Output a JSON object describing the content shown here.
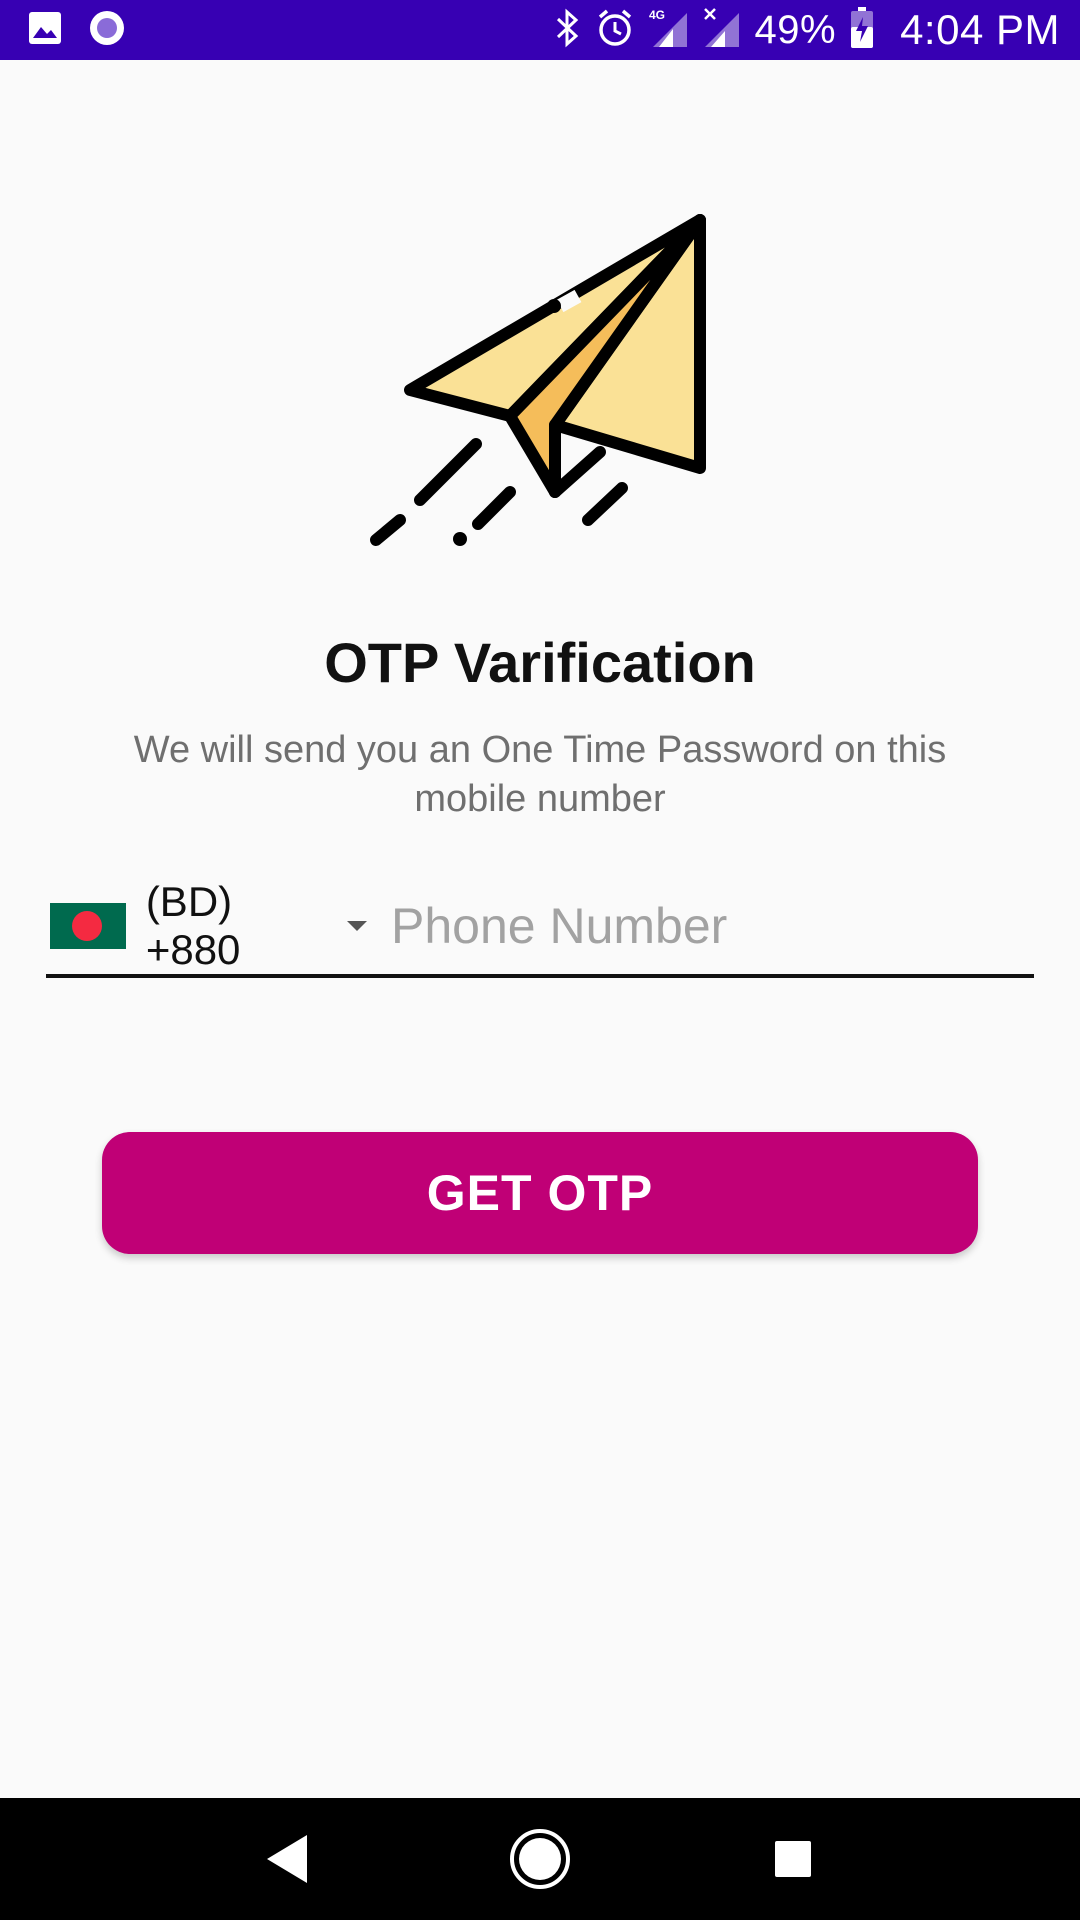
{
  "status_bar": {
    "battery": "49%",
    "time": "4:04 PM",
    "network": "4G",
    "icons": [
      "image-icon",
      "circle-app-icon",
      "bluetooth-icon",
      "alarm-icon",
      "signal-4g-icon",
      "signal-icon",
      "battery-icon"
    ]
  },
  "hero": {
    "icon": "paper-plane-icon"
  },
  "title": "OTP Varification",
  "subtitle": "We will send you an One Time Password on this mobile number",
  "phone": {
    "country_code": "(BD) +880",
    "placeholder": "Phone Number",
    "value": ""
  },
  "button": {
    "label": "GET OTP"
  },
  "nav": {
    "icons": [
      "back-icon",
      "home-icon",
      "recents-icon"
    ]
  },
  "colors": {
    "status_bar": "#3700b3",
    "button": "#c00076",
    "background": "#fafafa",
    "plane_light": "#fae196",
    "plane_dark": "#f5bd5a"
  }
}
